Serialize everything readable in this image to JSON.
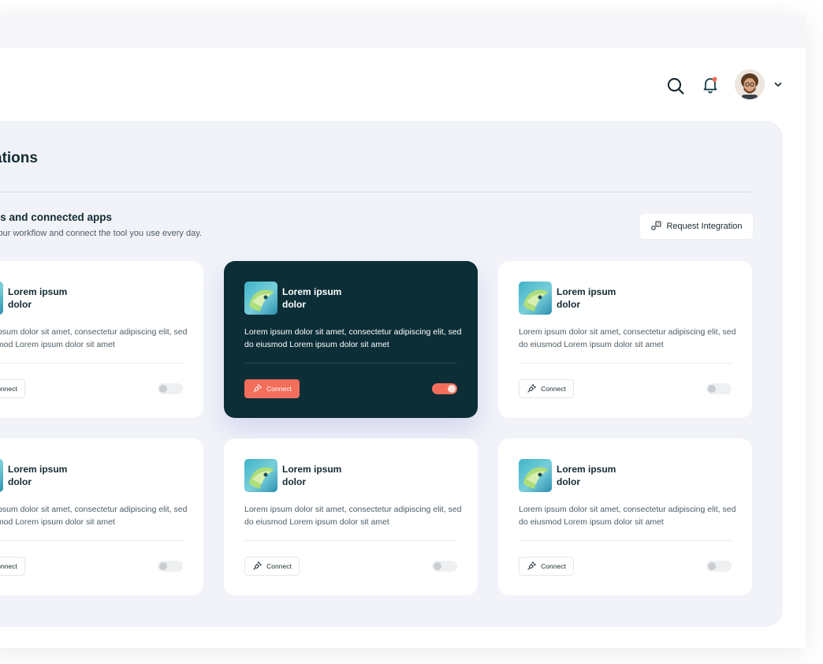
{
  "page": {
    "title": "ations",
    "subtitle": "ns and connected apps",
    "subtitle_desc": "your workflow and connect the tool you use every day.",
    "request_label": "Request Integration"
  },
  "header": {
    "search_icon": "search-icon",
    "bell_icon": "bell-icon",
    "chevron_icon": "chevron-down-icon",
    "notification_color": "#f46e5c"
  },
  "colors": {
    "accent": "#f46e5c",
    "dark_card": "#0b2e37",
    "panel_bg": "#f1f3f9"
  },
  "cards": [
    {
      "name": "Lorem ipsum dolor",
      "desc": "Lorem ipsum dolor sit amet, consectetur adipiscing elit, sed do eiusmod Lorem ipsum dolor sit amet",
      "connect": "Connect",
      "enabled": false,
      "active": false
    },
    {
      "name": "Lorem ipsum dolor",
      "desc": "Lorem ipsum dolor sit amet, consectetur adipiscing elit, sed do eiusmod Lorem ipsum dolor sit amet",
      "connect": "Connect",
      "enabled": true,
      "active": true
    },
    {
      "name": "Lorem ipsum dolor",
      "desc": "Lorem ipsum dolor sit amet, consectetur adipiscing elit, sed do eiusmod Lorem ipsum dolor sit amet",
      "connect": "Connect",
      "enabled": false,
      "active": false
    },
    {
      "name": "Lorem ipsum dolor",
      "desc": "Lorem ipsum dolor sit amet, consectetur adipiscing elit, sed do eiusmod Lorem ipsum dolor sit amet",
      "connect": "Connect",
      "enabled": false,
      "active": false
    },
    {
      "name": "Lorem ipsum dolor",
      "desc": "Lorem ipsum dolor sit amet, consectetur adipiscing elit, sed do eiusmod Lorem ipsum dolor sit amet",
      "connect": "Connect",
      "enabled": false,
      "active": false
    },
    {
      "name": "Lorem ipsum dolor",
      "desc": "Lorem ipsum dolor sit amet, consectetur adipiscing elit, sed do eiusmod Lorem ipsum dolor sit amet",
      "connect": "Connect",
      "enabled": false,
      "active": false
    }
  ]
}
